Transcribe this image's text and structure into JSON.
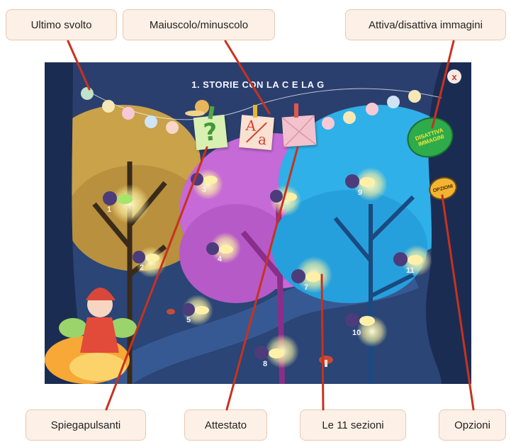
{
  "callouts": {
    "last_done": "Ultimo svolto",
    "case_toggle": "Maiuscolo/minuscolo",
    "images_toggle": "Attiva/disattiva immagini",
    "button_help": "Spiegapulsanti",
    "certificate": "Attestato",
    "sections": "Le 11 sezioni",
    "options": "Opzioni"
  },
  "game": {
    "title": "1. STORIE CON LA C E LA G",
    "help_symbol": "?",
    "case_symbol_upper": "A",
    "case_symbol_lower": "a",
    "images_button_line1": "DISATTIVA",
    "images_button_line2": "IMMAGINI",
    "options_button_label": "OPZIONI",
    "close_symbol": "x",
    "sections": [
      "1",
      "2",
      "3",
      "4",
      "5",
      "6",
      "7",
      "8",
      "9",
      "10",
      "11"
    ]
  },
  "colors": {
    "arrow": "#c8321e",
    "sky": "#2b3f6e",
    "tree_brown": "#c9a24a",
    "tree_purple": "#c56ad6",
    "tree_blue": "#2fb0e8"
  }
}
